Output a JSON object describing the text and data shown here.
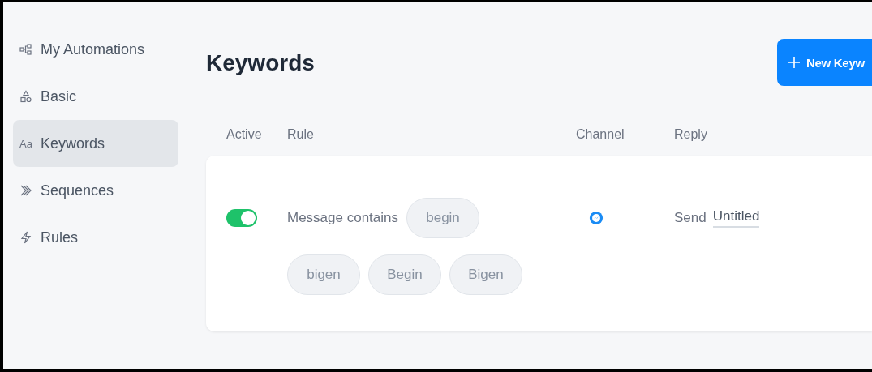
{
  "sidebar": {
    "items": [
      {
        "label": "My Automations",
        "kind": "automations",
        "selected": false
      },
      {
        "label": "Basic",
        "kind": "basic",
        "selected": false
      },
      {
        "label": "Keywords",
        "kind": "keywords",
        "icon_text": "Aa",
        "selected": true
      },
      {
        "label": "Sequences",
        "kind": "sequences",
        "selected": false
      },
      {
        "label": "Rules",
        "kind": "rules",
        "selected": false
      }
    ]
  },
  "title": "Keywords",
  "new_button": {
    "label": "New Keyw"
  },
  "table": {
    "columns": [
      "Active",
      "Rule",
      "Channel",
      "Reply"
    ],
    "rows": [
      {
        "active": true,
        "rule": "Message contains",
        "keywords": [
          "begin",
          "bigen",
          "Begin",
          "Bigen"
        ],
        "reply_prefix": "Send",
        "reply": "Untitled"
      }
    ]
  }
}
